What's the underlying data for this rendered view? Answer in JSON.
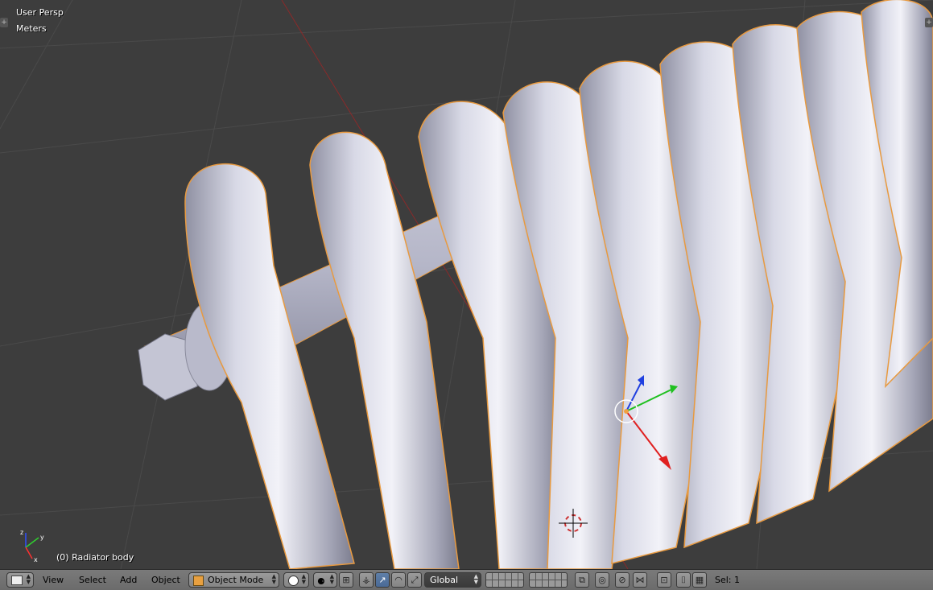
{
  "viewport": {
    "view_name": "User Persp",
    "units": "Meters",
    "object_info": "(0) Radiator body"
  },
  "header": {
    "menus": [
      "View",
      "Select",
      "Add",
      "Object"
    ],
    "mode": "Object Mode",
    "orientation": "Global",
    "selection_info": "Sel: 1"
  },
  "colors": {
    "background": "#3d3d3d",
    "selection_outline": "#f0a040",
    "axis_x": "#e02020",
    "axis_y": "#20c020",
    "axis_z": "#2040e0"
  }
}
